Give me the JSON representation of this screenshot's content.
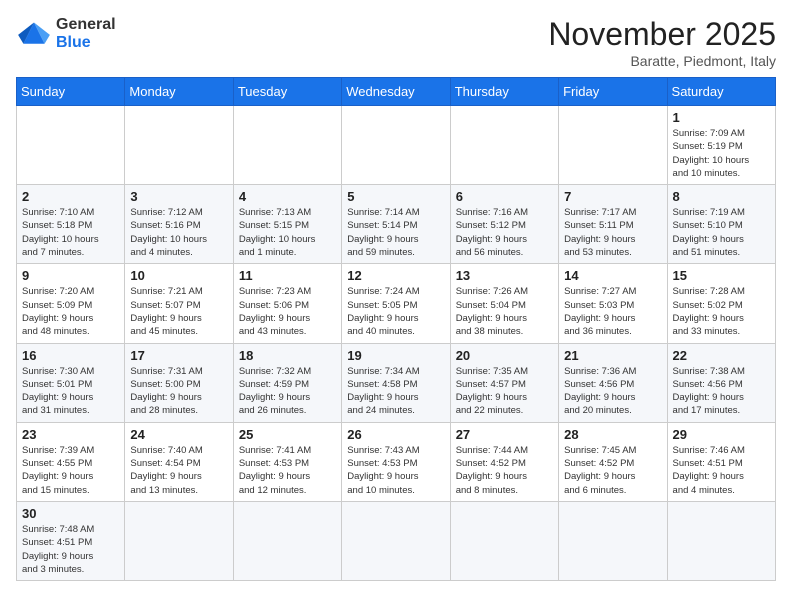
{
  "header": {
    "logo_line1": "General",
    "logo_line2": "Blue",
    "month_title": "November 2025",
    "location": "Baratte, Piedmont, Italy"
  },
  "weekdays": [
    "Sunday",
    "Monday",
    "Tuesday",
    "Wednesday",
    "Thursday",
    "Friday",
    "Saturday"
  ],
  "weeks": [
    [
      {
        "day": "",
        "info": ""
      },
      {
        "day": "",
        "info": ""
      },
      {
        "day": "",
        "info": ""
      },
      {
        "day": "",
        "info": ""
      },
      {
        "day": "",
        "info": ""
      },
      {
        "day": "",
        "info": ""
      },
      {
        "day": "1",
        "info": "Sunrise: 7:09 AM\nSunset: 5:19 PM\nDaylight: 10 hours\nand 10 minutes."
      }
    ],
    [
      {
        "day": "2",
        "info": "Sunrise: 7:10 AM\nSunset: 5:18 PM\nDaylight: 10 hours\nand 7 minutes."
      },
      {
        "day": "3",
        "info": "Sunrise: 7:12 AM\nSunset: 5:16 PM\nDaylight: 10 hours\nand 4 minutes."
      },
      {
        "day": "4",
        "info": "Sunrise: 7:13 AM\nSunset: 5:15 PM\nDaylight: 10 hours\nand 1 minute."
      },
      {
        "day": "5",
        "info": "Sunrise: 7:14 AM\nSunset: 5:14 PM\nDaylight: 9 hours\nand 59 minutes."
      },
      {
        "day": "6",
        "info": "Sunrise: 7:16 AM\nSunset: 5:12 PM\nDaylight: 9 hours\nand 56 minutes."
      },
      {
        "day": "7",
        "info": "Sunrise: 7:17 AM\nSunset: 5:11 PM\nDaylight: 9 hours\nand 53 minutes."
      },
      {
        "day": "8",
        "info": "Sunrise: 7:19 AM\nSunset: 5:10 PM\nDaylight: 9 hours\nand 51 minutes."
      }
    ],
    [
      {
        "day": "9",
        "info": "Sunrise: 7:20 AM\nSunset: 5:09 PM\nDaylight: 9 hours\nand 48 minutes."
      },
      {
        "day": "10",
        "info": "Sunrise: 7:21 AM\nSunset: 5:07 PM\nDaylight: 9 hours\nand 45 minutes."
      },
      {
        "day": "11",
        "info": "Sunrise: 7:23 AM\nSunset: 5:06 PM\nDaylight: 9 hours\nand 43 minutes."
      },
      {
        "day": "12",
        "info": "Sunrise: 7:24 AM\nSunset: 5:05 PM\nDaylight: 9 hours\nand 40 minutes."
      },
      {
        "day": "13",
        "info": "Sunrise: 7:26 AM\nSunset: 5:04 PM\nDaylight: 9 hours\nand 38 minutes."
      },
      {
        "day": "14",
        "info": "Sunrise: 7:27 AM\nSunset: 5:03 PM\nDaylight: 9 hours\nand 36 minutes."
      },
      {
        "day": "15",
        "info": "Sunrise: 7:28 AM\nSunset: 5:02 PM\nDaylight: 9 hours\nand 33 minutes."
      }
    ],
    [
      {
        "day": "16",
        "info": "Sunrise: 7:30 AM\nSunset: 5:01 PM\nDaylight: 9 hours\nand 31 minutes."
      },
      {
        "day": "17",
        "info": "Sunrise: 7:31 AM\nSunset: 5:00 PM\nDaylight: 9 hours\nand 28 minutes."
      },
      {
        "day": "18",
        "info": "Sunrise: 7:32 AM\nSunset: 4:59 PM\nDaylight: 9 hours\nand 26 minutes."
      },
      {
        "day": "19",
        "info": "Sunrise: 7:34 AM\nSunset: 4:58 PM\nDaylight: 9 hours\nand 24 minutes."
      },
      {
        "day": "20",
        "info": "Sunrise: 7:35 AM\nSunset: 4:57 PM\nDaylight: 9 hours\nand 22 minutes."
      },
      {
        "day": "21",
        "info": "Sunrise: 7:36 AM\nSunset: 4:56 PM\nDaylight: 9 hours\nand 20 minutes."
      },
      {
        "day": "22",
        "info": "Sunrise: 7:38 AM\nSunset: 4:56 PM\nDaylight: 9 hours\nand 17 minutes."
      }
    ],
    [
      {
        "day": "23",
        "info": "Sunrise: 7:39 AM\nSunset: 4:55 PM\nDaylight: 9 hours\nand 15 minutes."
      },
      {
        "day": "24",
        "info": "Sunrise: 7:40 AM\nSunset: 4:54 PM\nDaylight: 9 hours\nand 13 minutes."
      },
      {
        "day": "25",
        "info": "Sunrise: 7:41 AM\nSunset: 4:53 PM\nDaylight: 9 hours\nand 12 minutes."
      },
      {
        "day": "26",
        "info": "Sunrise: 7:43 AM\nSunset: 4:53 PM\nDaylight: 9 hours\nand 10 minutes."
      },
      {
        "day": "27",
        "info": "Sunrise: 7:44 AM\nSunset: 4:52 PM\nDaylight: 9 hours\nand 8 minutes."
      },
      {
        "day": "28",
        "info": "Sunrise: 7:45 AM\nSunset: 4:52 PM\nDaylight: 9 hours\nand 6 minutes."
      },
      {
        "day": "29",
        "info": "Sunrise: 7:46 AM\nSunset: 4:51 PM\nDaylight: 9 hours\nand 4 minutes."
      }
    ],
    [
      {
        "day": "30",
        "info": "Sunrise: 7:48 AM\nSunset: 4:51 PM\nDaylight: 9 hours\nand 3 minutes."
      },
      {
        "day": "",
        "info": ""
      },
      {
        "day": "",
        "info": ""
      },
      {
        "day": "",
        "info": ""
      },
      {
        "day": "",
        "info": ""
      },
      {
        "day": "",
        "info": ""
      },
      {
        "day": "",
        "info": ""
      }
    ]
  ]
}
